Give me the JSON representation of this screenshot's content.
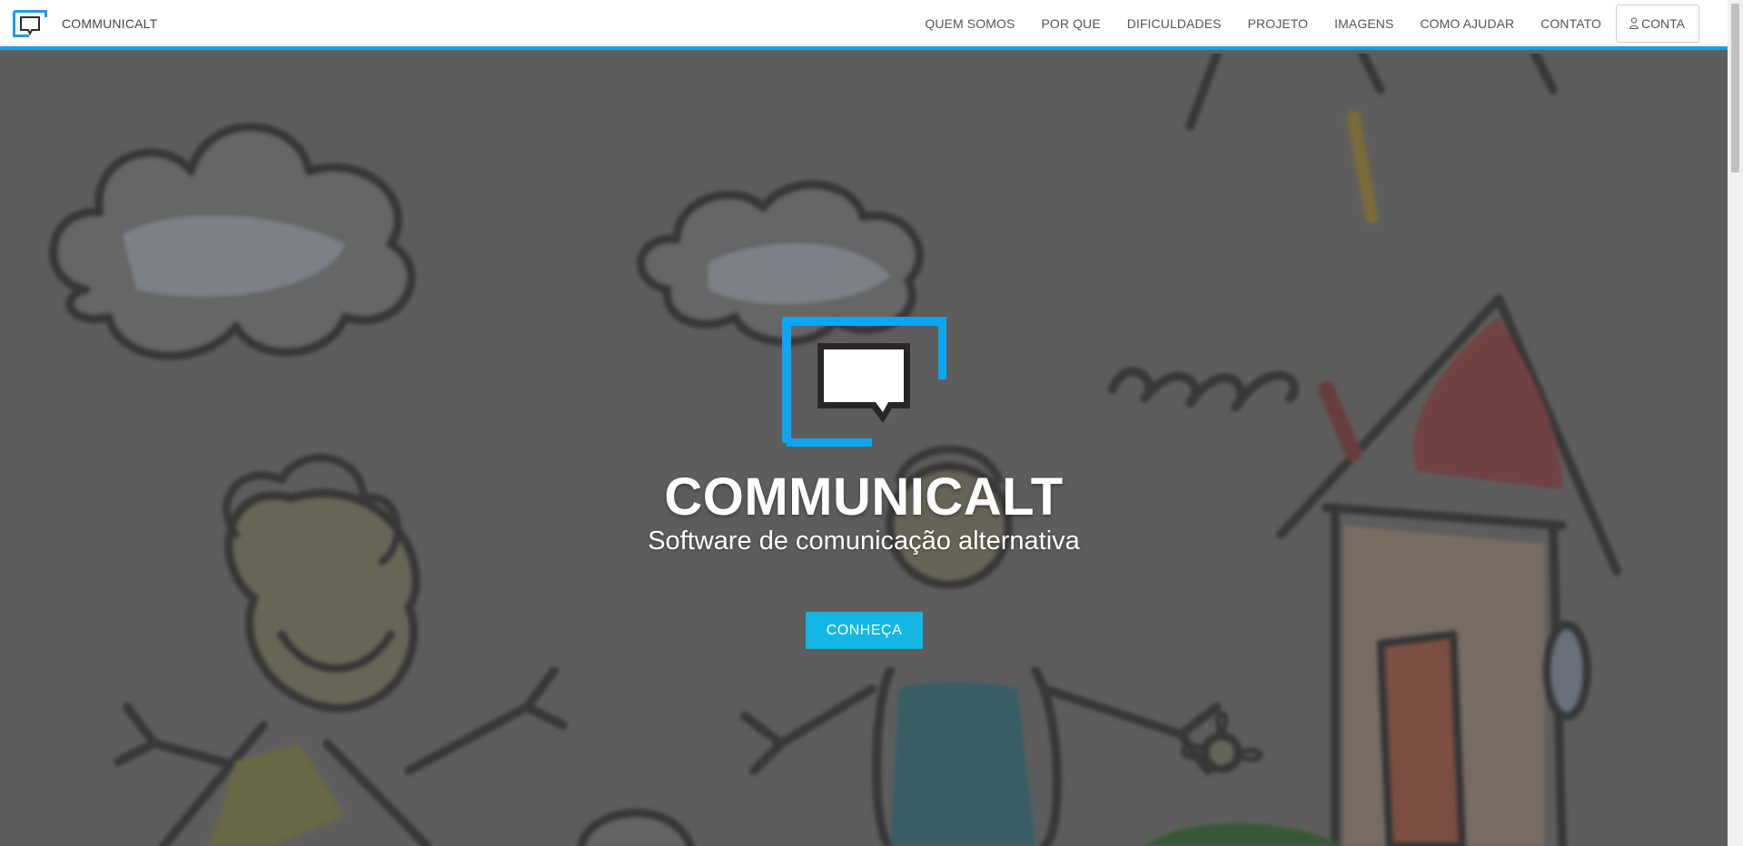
{
  "navbar": {
    "brand": "COMMUNICALT",
    "links": [
      "QUEM SOMOS",
      "POR QUE",
      "DIFICULDADES",
      "PROJETO",
      "IMAGENS",
      "COMO AJUDAR",
      "CONTATO"
    ],
    "account_label": "CONTA"
  },
  "hero": {
    "title": "COMMUNICALT",
    "subtitle": "Software de comunicação alternativa",
    "cta_label": "CONHEÇA"
  },
  "colors": {
    "accent": "#1e9be6",
    "cta": "#12b7e4",
    "overlay": "#5f5f5f"
  },
  "icons": {
    "brand": "speech-bubble-logo-icon",
    "account": "user-icon"
  }
}
